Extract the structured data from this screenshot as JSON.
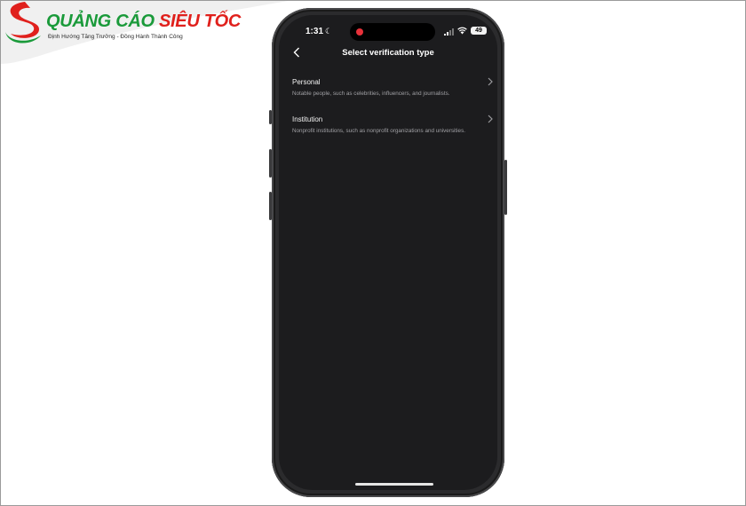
{
  "logo": {
    "title_part1": "QUẢNG CÁO ",
    "title_part2": "SIÊU TỐC",
    "tagline": "Định Hướng Tăng Trưởng - Đồng Hành Thành Công",
    "colors": {
      "green": "#1a9a3a",
      "red": "#e0201c"
    }
  },
  "status_bar": {
    "time": "1:31",
    "focus_icon": "moon-icon",
    "signal_icon": "signal-icon",
    "wifi_icon": "wifi-icon",
    "battery": "49"
  },
  "nav": {
    "back_icon": "chevron-left-icon",
    "title": "Select verification type"
  },
  "options": [
    {
      "title": "Personal",
      "description": "Notable people, such as celebrities, influencers, and journalists.",
      "icon": "chevron-right-icon"
    },
    {
      "title": "Institution",
      "description": "Nonprofit institutions, such as nonprofit organizations and universities.",
      "icon": "chevron-right-icon"
    }
  ],
  "colors": {
    "screen_bg": "#1c1c1e",
    "phone_body": "#2b2b2d",
    "recording_dot": "#e8313a"
  }
}
